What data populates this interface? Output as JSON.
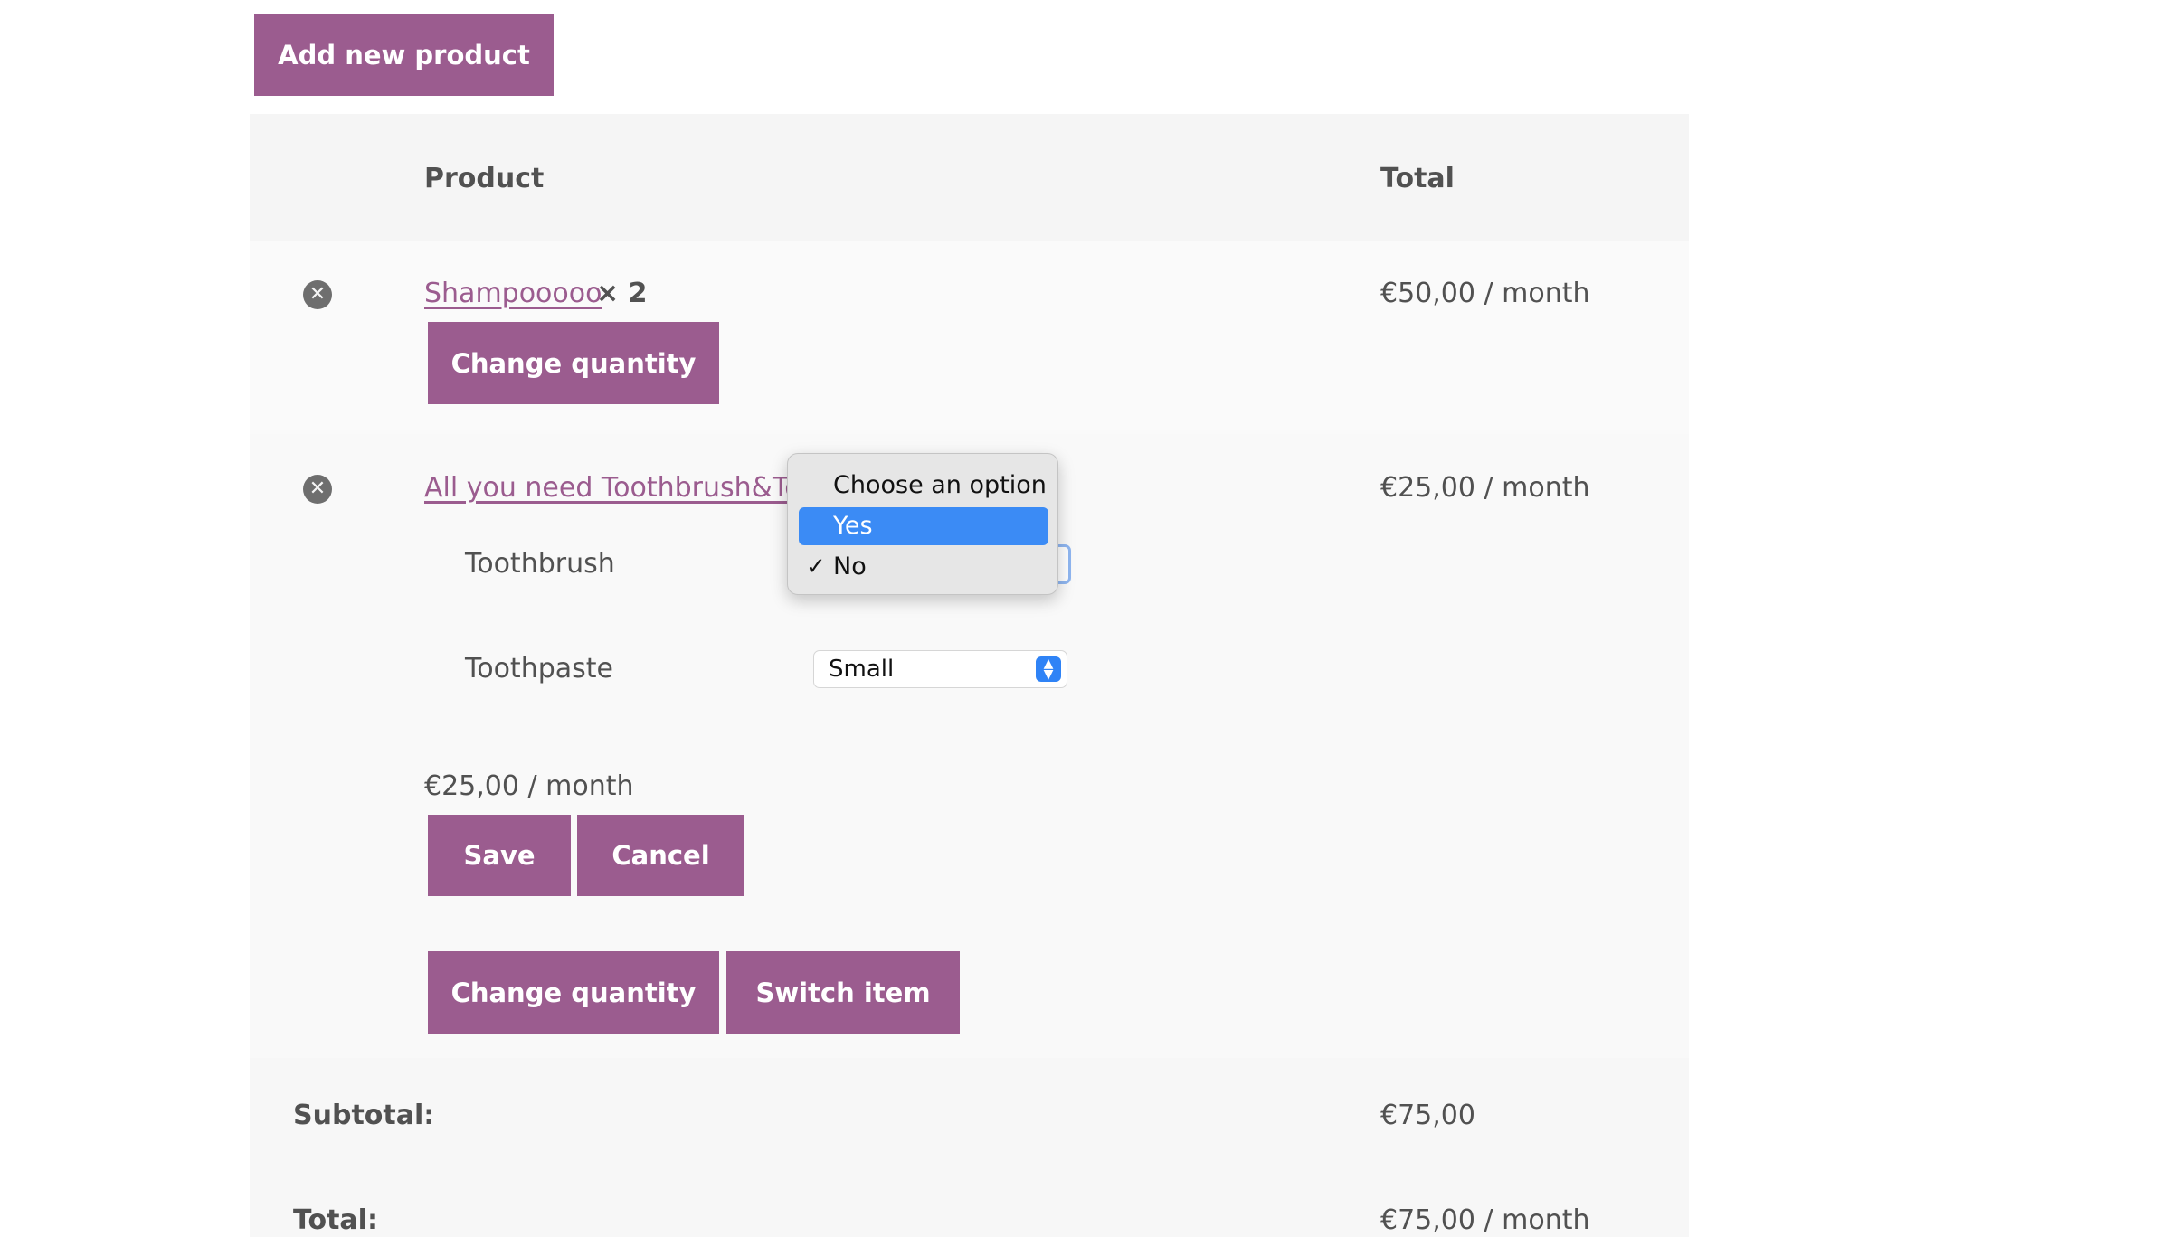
{
  "actions": {
    "add_product": "Add new product"
  },
  "table": {
    "col_product": "Product",
    "col_total": "Total"
  },
  "items": [
    {
      "name": "Shampooooo",
      "qty": "× 2",
      "total": "€50,00 / month",
      "change_qty": "Change quantity"
    },
    {
      "name": "All you need Toothbrush&Toot",
      "total": "€25,00 / month",
      "attributes": [
        {
          "label": "Toothbrush",
          "value": "No"
        },
        {
          "label": "Toothpaste",
          "value": "Small"
        }
      ],
      "price": "€25,00 / month",
      "save": "Save",
      "cancel": "Cancel",
      "change_qty": "Change quantity",
      "switch": "Switch item"
    }
  ],
  "dropdown": {
    "options": [
      "Choose an option",
      "Yes",
      "No"
    ],
    "highlighted": "Yes",
    "checked": "No",
    "check_glyph": "✓"
  },
  "totals": {
    "subtotal_label": "Subtotal:",
    "subtotal_value": "€75,00",
    "total_label": "Total:",
    "total_value": "€75,00 / month"
  },
  "icons": {
    "remove": "remove-circle-icon",
    "select_arrows": "select-arrows-icon"
  },
  "colors": {
    "accent": "#9b5c8f",
    "select_highlight": "#3b8bf5"
  }
}
